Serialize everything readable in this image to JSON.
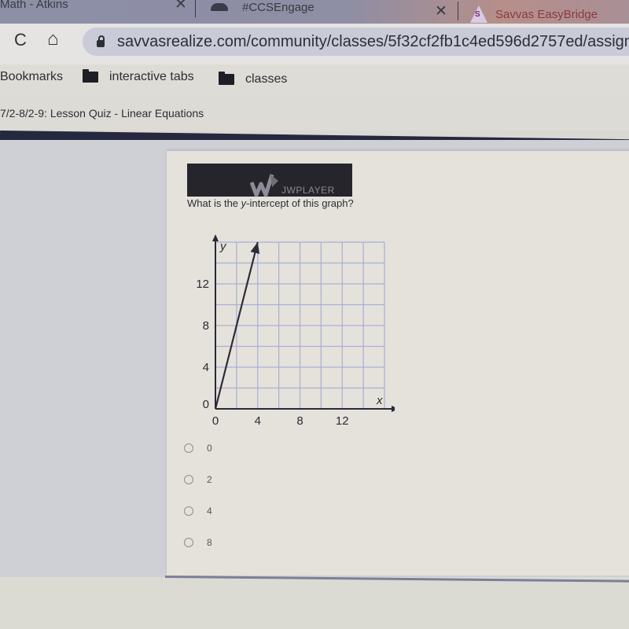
{
  "browser": {
    "tabs": [
      {
        "title": "Math - Atkins",
        "close": "✕"
      },
      {
        "title": "#CCSEngage",
        "close": "✕"
      },
      {
        "title": "Savvas EasyBridge",
        "icon_letter": "S"
      }
    ],
    "nav": {
      "reload": "C",
      "home": "⌂"
    },
    "url": "savvasrealize.com/community/classes/5f32cf2fb1c4ed596d2757ed/assign",
    "bookmarks": [
      {
        "label": "Bookmarks"
      },
      {
        "label": "interactive tabs"
      },
      {
        "label": "classes"
      }
    ]
  },
  "page": {
    "breadcrumb": "7/2-8/2-9: Lesson Quiz - Linear Equations",
    "video_watermark": "JWPLAYER",
    "question": {
      "prefix": "What is the ",
      "italic": "y",
      "suffix": "-intercept of this graph?"
    },
    "options": [
      {
        "label": "0",
        "selected": false
      },
      {
        "label": "2",
        "selected": false
      },
      {
        "label": "4",
        "selected": false
      },
      {
        "label": "8",
        "selected": false
      }
    ]
  },
  "chart_data": {
    "type": "line",
    "title": "",
    "xlabel": "x",
    "ylabel": "y",
    "xlim": [
      0,
      16
    ],
    "ylim": [
      0,
      16
    ],
    "grid": true,
    "grid_step": 2,
    "x_ticks": [
      0,
      4,
      8,
      12
    ],
    "y_ticks": [
      0,
      4,
      8,
      12
    ],
    "x_tick_labels": [
      "0",
      "4",
      "8",
      "12"
    ],
    "y_tick_labels": [
      "0",
      "4",
      "8",
      "12"
    ],
    "series": [
      {
        "name": "line",
        "x": [
          0,
          4
        ],
        "y": [
          0,
          16
        ],
        "arrow_end": true
      }
    ]
  }
}
